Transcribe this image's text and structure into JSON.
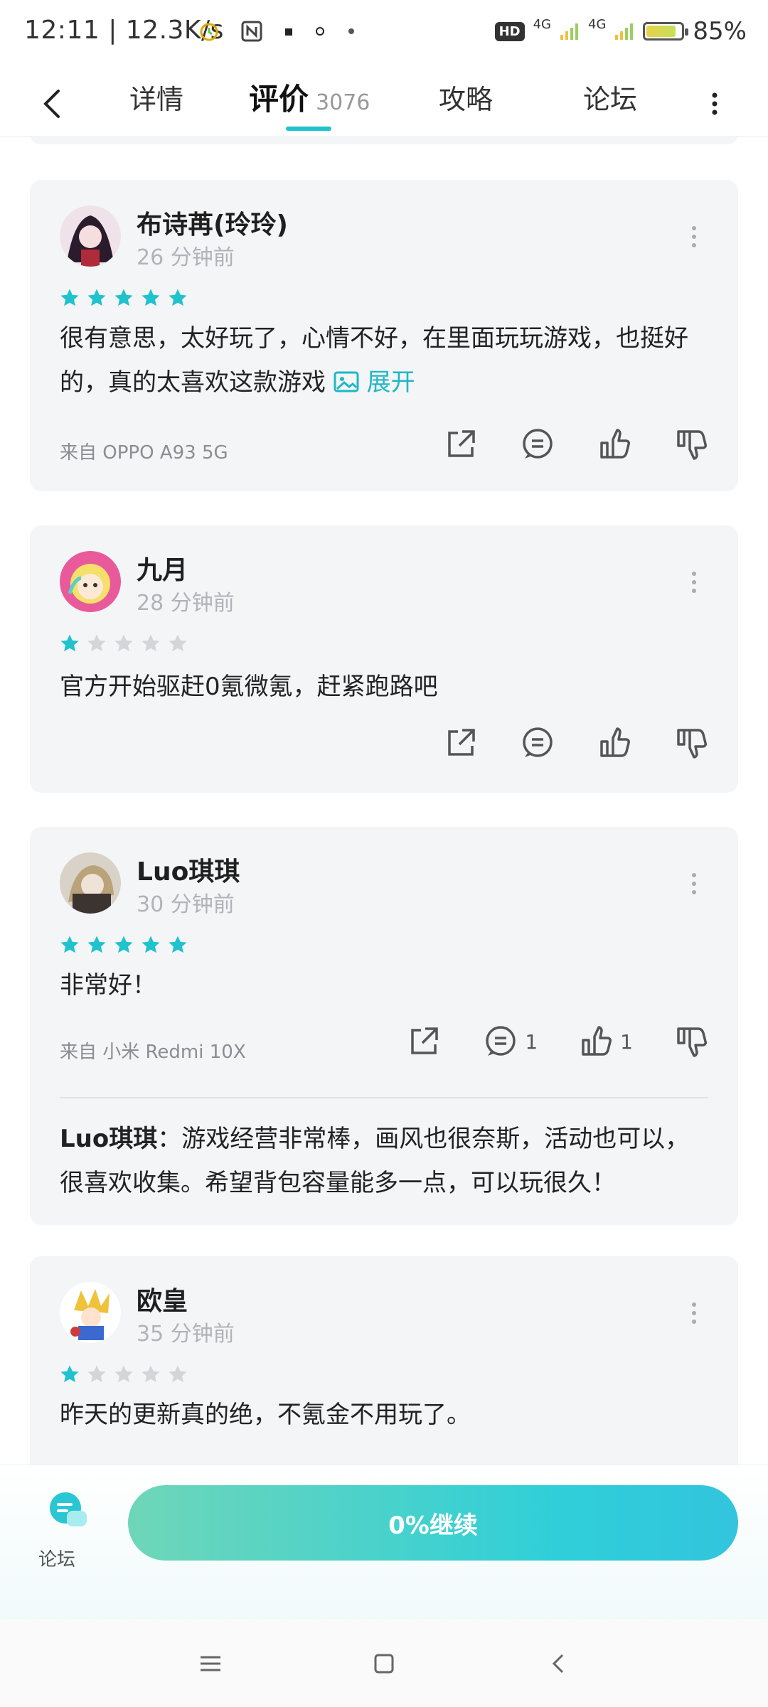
{
  "status": {
    "time_speed": "12:11 | 12.3K/s",
    "hd": "HD",
    "net1": "4G",
    "net2": "4G",
    "battery": "85%",
    "battery_level": 0.85
  },
  "nav": {
    "tabs": [
      "详情",
      "评价",
      "攻略",
      "论坛"
    ],
    "review_count": "3076",
    "active_tab": "评价"
  },
  "reviews": [
    {
      "name": "布诗苒(玲玲)",
      "time": "26 分钟前",
      "rating": 5,
      "text": "很有意思，太好玩了，心情不好，在里面玩玩游戏，也挺好的，真的太喜欢这款游戏",
      "expand": "展开",
      "device": "来自 OPPO A93 5G"
    },
    {
      "name": "九月",
      "time": "28 分钟前",
      "rating": 1,
      "text": "官方开始驱赶0氪微氪，赶紧跑路吧",
      "device": ""
    },
    {
      "name": "Luo琪琪",
      "time": "30 分钟前",
      "rating": 5,
      "text": "非常好！",
      "device": "来自 小米 Redmi 10X",
      "comment_count": "1",
      "like_count": "1",
      "reply_author": "Luo琪琪",
      "reply_text": "：游戏经营非常棒，画风也很奈斯，活动也可以，很喜欢收集。希望背包容量能多一点，可以玩很久！"
    },
    {
      "name": "欧皇",
      "time": "35 分钟前",
      "rating": 1,
      "text": "昨天的更新真的绝，不氪金不用玩了。"
    }
  ],
  "bottom": {
    "forum_label": "论坛",
    "continue_label": "0%继续"
  },
  "colors": {
    "accent": "#1fc2cd",
    "star_on": "#1fc2cd",
    "star_off": "#d3d5d9",
    "card_bg": "#f4f5f7"
  }
}
